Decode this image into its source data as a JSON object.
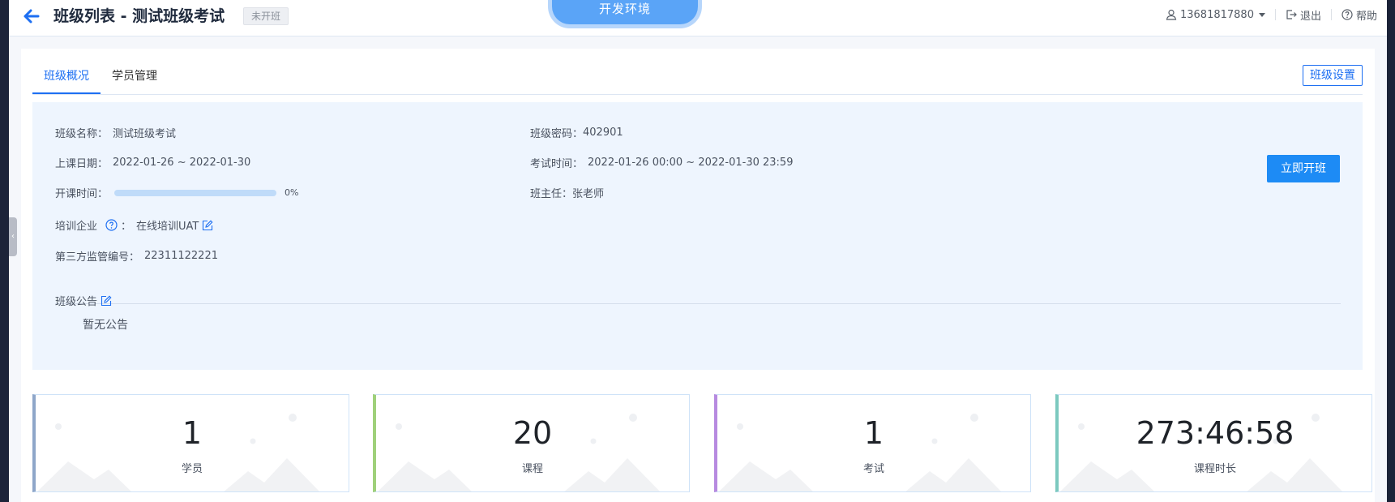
{
  "header": {
    "title": "班级列表 - 测试班级考试",
    "status_badge": "未开班",
    "env_banner": "开发环境",
    "user": "13681817880",
    "logout": "退出",
    "help": "帮助"
  },
  "tabs": [
    {
      "label": "班级概况",
      "active": true
    },
    {
      "label": "学员管理",
      "active": false
    }
  ],
  "settings_button": "班级设置",
  "info": {
    "class_name_label": "班级名称：",
    "class_name": "测试班级考试",
    "class_password_label": "班级密码：",
    "class_password": "402901",
    "course_date_label": "上课日期：",
    "course_date": "2022-01-26 ~ 2022-01-30",
    "exam_time_label": "考试时间：",
    "exam_time": "2022-01-26 00:00 ~ 2022-01-30 23:59",
    "start_time_label": "开课时间：",
    "progress_percent": 0,
    "progress_text": "0%",
    "head_teacher_label": "班主任：",
    "head_teacher": "张老师",
    "enterprise_label": "培训企业",
    "enterprise_colon": "：",
    "enterprise": "在线培训UAT",
    "supervision_label": "第三方监管编号：",
    "supervision_no": "22311122221",
    "notice_label": "班级公告",
    "notice": "暂无公告"
  },
  "start_button": "立即开班",
  "stats": [
    {
      "value": "1",
      "label": "学员",
      "accent": "#8ea6c9"
    },
    {
      "value": "20",
      "label": "课程",
      "accent": "#9fd07a"
    },
    {
      "value": "1",
      "label": "考试",
      "accent": "#b78ae0"
    },
    {
      "value": "273:46:58",
      "label": "课程时长",
      "accent": "#7cc9bf"
    }
  ],
  "colors": {
    "primary": "#1d6ff2",
    "button": "#1d8bf5",
    "panel_bg": "#eef5fe"
  }
}
